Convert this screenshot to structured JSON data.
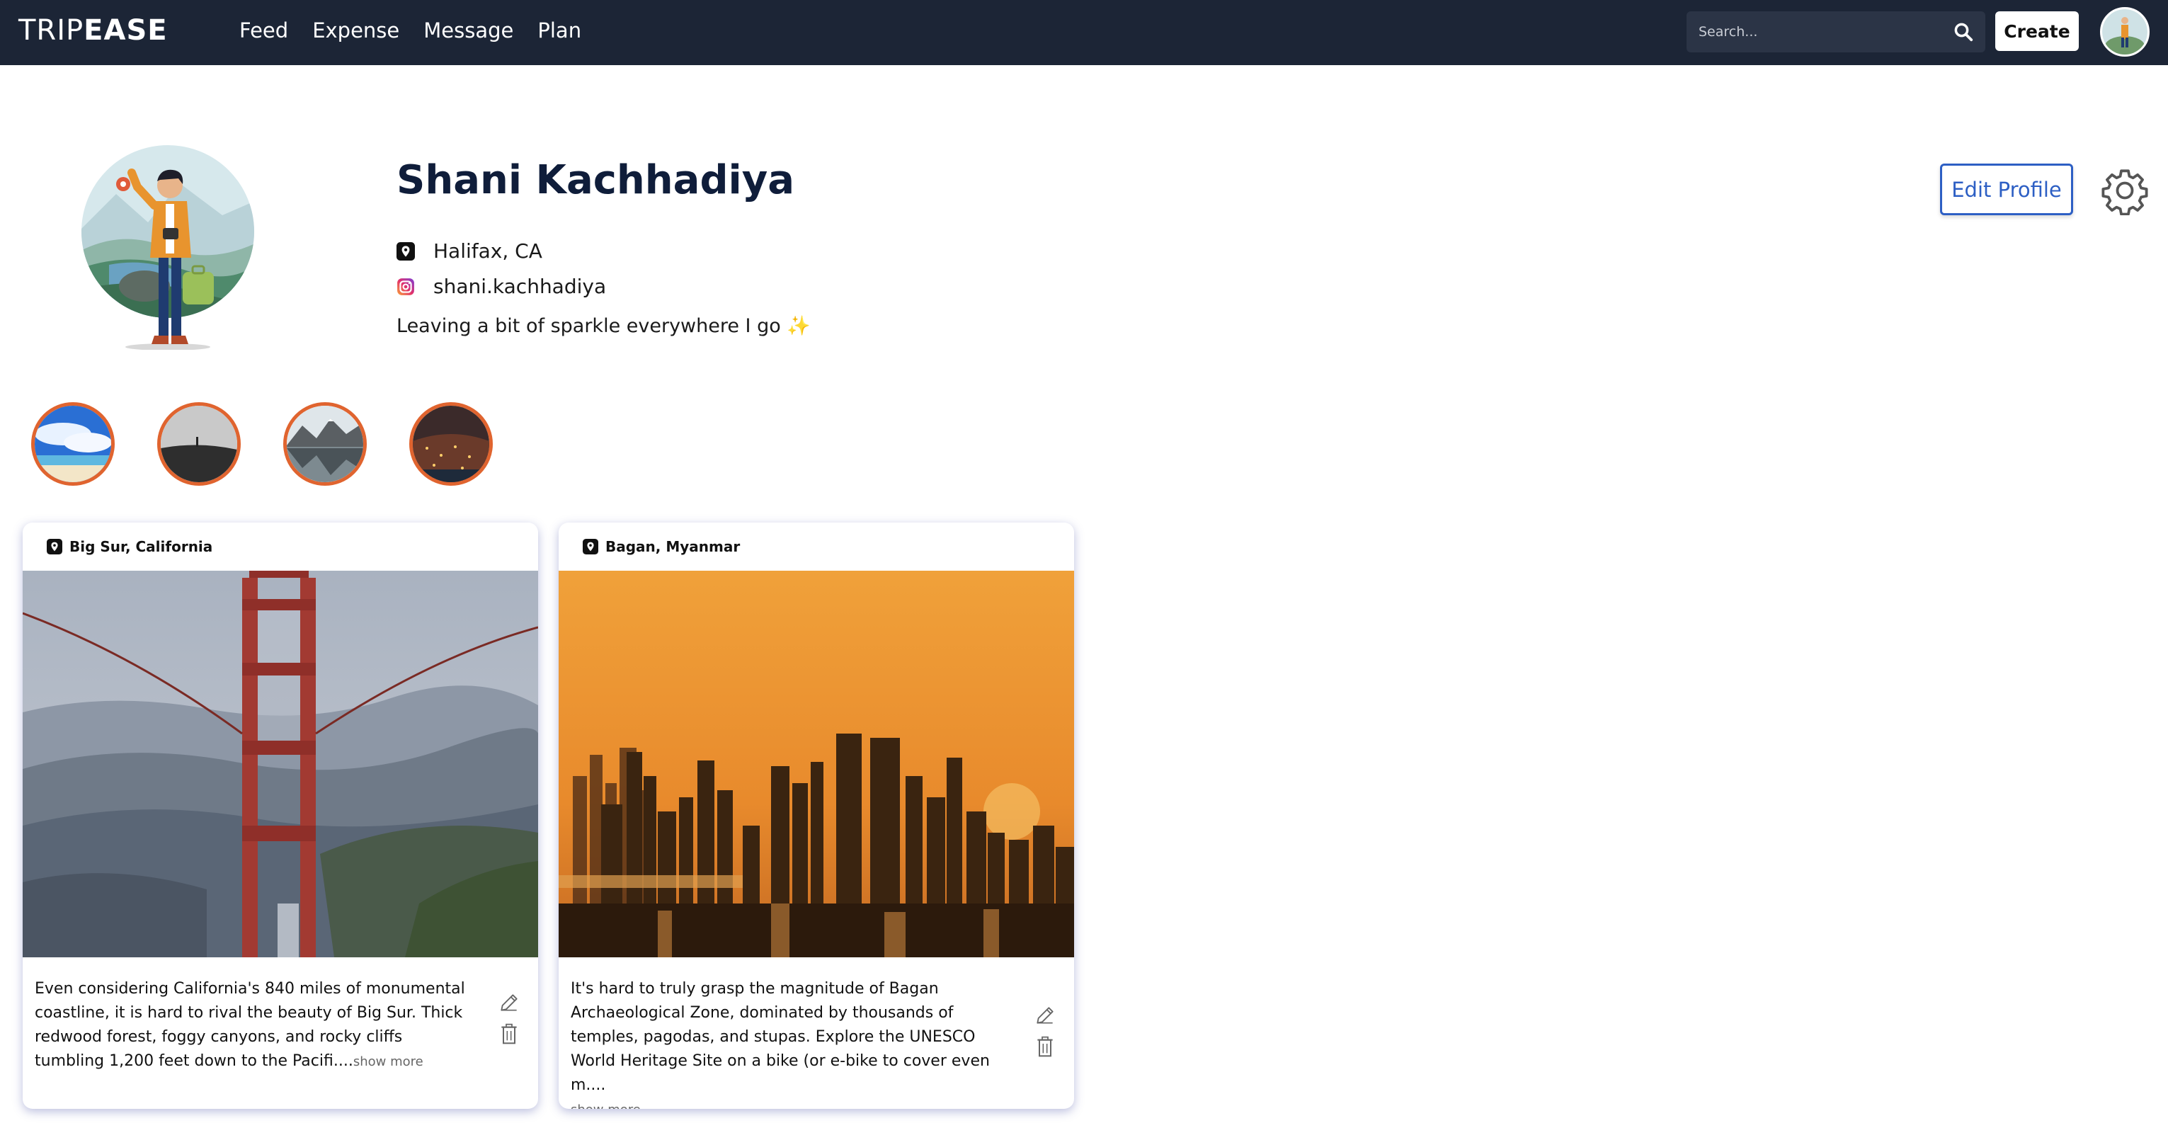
{
  "nav": {
    "logo_a": "TRIP",
    "logo_b": "EASE",
    "links": [
      "Feed",
      "Expense",
      "Message",
      "Plan"
    ],
    "search_placeholder": "Search...",
    "create_label": "Create"
  },
  "profile": {
    "name": "Shani Kachhadiya",
    "location": "Halifax, CA",
    "instagram": "shani.kachhadiya",
    "bio": "Leaving a bit of sparkle everywhere I go ✨",
    "edit_label": "Edit Profile"
  },
  "stories": [
    "beach-sky",
    "foggy-hill",
    "mountain-lake",
    "night-city"
  ],
  "posts": [
    {
      "location": "Big Sur, California",
      "text": "Even considering California's 840 miles of monumental coastline, it is hard to rival the beauty of Big Sur. Thick redwood forest, foggy canyons, and rocky cliffs tumbling 1,200 feet down to the Pacifi....",
      "show_more": "show more"
    },
    {
      "location": "Bagan, Myanmar",
      "text": "It's hard to truly grasp the magnitude of Bagan Archaeological Zone, dominated by thousands of temples, pagodas, and stupas. Explore the UNESCO World Heritage Site on a bike (or e-bike to cover even m....",
      "show_more": "show more"
    }
  ],
  "colors": {
    "navbar": "#1c2536",
    "accent_blue": "#2d5fc4",
    "story_ring": "#e0642f",
    "name": "#0f1d3a"
  }
}
